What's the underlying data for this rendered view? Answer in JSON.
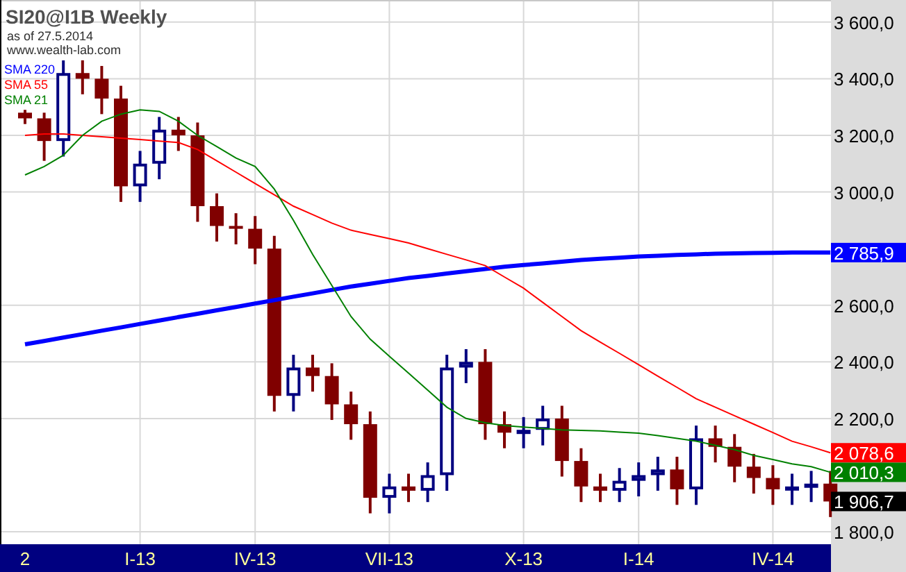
{
  "chart_data": {
    "type": "candlestick",
    "title": "SI20@I1B Weekly",
    "categories": [
      "2",
      null,
      null,
      null,
      null,
      null,
      "I-13",
      null,
      null,
      null,
      null,
      null,
      "IV-13",
      null,
      null,
      null,
      null,
      null,
      null,
      "VII-13",
      null,
      null,
      null,
      null,
      null,
      null,
      "X-13",
      null,
      null,
      null,
      null,
      null,
      "I-14",
      null,
      null,
      null,
      null,
      null,
      null,
      "IV-14",
      null,
      null,
      null
    ],
    "ylim": [
      1756,
      3678
    ],
    "grid": true,
    "yticks": [
      {
        "value": 3600,
        "label": "3 600,0"
      },
      {
        "value": 3400,
        "label": "3 400,0"
      },
      {
        "value": 3200,
        "label": "3 200,0"
      },
      {
        "value": 3000,
        "label": "3 000,0"
      },
      {
        "value": 2600,
        "label": "2 600,0"
      },
      {
        "value": 2400,
        "label": "2 400,0"
      },
      {
        "value": 2200,
        "label": "2 200,0"
      },
      {
        "value": 1800,
        "label": "1 800,0"
      }
    ],
    "ohlc": [
      [
        3280,
        3290,
        3240,
        3260
      ],
      [
        3260,
        3280,
        3110,
        3180
      ],
      [
        3180,
        3465,
        3125,
        3420
      ],
      [
        3420,
        3465,
        3345,
        3400
      ],
      [
        3400,
        3445,
        3275,
        3330
      ],
      [
        3330,
        3375,
        2965,
        3020
      ],
      [
        3020,
        3145,
        2965,
        3100
      ],
      [
        3100,
        3265,
        3045,
        3220
      ],
      [
        3220,
        3265,
        3145,
        3200
      ],
      [
        3200,
        3245,
        2895,
        2950
      ],
      [
        2950,
        2995,
        2825,
        2880
      ],
      [
        2880,
        2925,
        2815,
        2870
      ],
      [
        2870,
        2915,
        2745,
        2800
      ],
      [
        2800,
        2845,
        2225,
        2280
      ],
      [
        2280,
        2425,
        2225,
        2380
      ],
      [
        2380,
        2425,
        2295,
        2350
      ],
      [
        2350,
        2395,
        2195,
        2250
      ],
      [
        2250,
        2295,
        2125,
        2180
      ],
      [
        2180,
        2225,
        1865,
        1920
      ],
      [
        1920,
        2005,
        1865,
        1960
      ],
      [
        1960,
        2005,
        1905,
        1945
      ],
      [
        1945,
        2045,
        1905,
        2000
      ],
      [
        2000,
        2425,
        1945,
        2380
      ],
      [
        2380,
        2445,
        2325,
        2400
      ],
      [
        2400,
        2445,
        2125,
        2180
      ],
      [
        2180,
        2225,
        2095,
        2150
      ],
      [
        2150,
        2205,
        2095,
        2160
      ],
      [
        2160,
        2245,
        2105,
        2200
      ],
      [
        2200,
        2245,
        1995,
        2050
      ],
      [
        2050,
        2095,
        1905,
        1960
      ],
      [
        1960,
        2005,
        1905,
        1945
      ],
      [
        1945,
        2025,
        1905,
        1980
      ],
      [
        1980,
        2045,
        1925,
        2000
      ],
      [
        2000,
        2065,
        1945,
        2020
      ],
      [
        2020,
        2065,
        1895,
        1950
      ],
      [
        1950,
        2175,
        1895,
        2130
      ],
      [
        2130,
        2175,
        2045,
        2100
      ],
      [
        2100,
        2145,
        1975,
        2030
      ],
      [
        2030,
        2075,
        1935,
        1990
      ],
      [
        1990,
        2035,
        1895,
        1950
      ],
      [
        1950,
        2005,
        1895,
        1960
      ],
      [
        1960,
        2015,
        1905,
        1970
      ],
      [
        1970,
        2015,
        1852,
        1907
      ]
    ],
    "series": [
      {
        "name": "SMA 220",
        "type": "line",
        "color": "#0000ff",
        "values": [
          2462,
          2474,
          2486,
          2498,
          2510,
          2522,
          2534,
          2546,
          2558,
          2570,
          2582,
          2594,
          2606,
          2618,
          2630,
          2642,
          2654,
          2666,
          2676,
          2686,
          2696,
          2704,
          2712,
          2720,
          2728,
          2736,
          2742,
          2748,
          2754,
          2760,
          2764,
          2768,
          2772,
          2775,
          2778,
          2780,
          2782,
          2783,
          2784,
          2785,
          2786,
          2786,
          2786
        ]
      },
      {
        "name": "SMA 55",
        "type": "line",
        "color": "#ff0000",
        "values": [
          3200,
          3205,
          3205,
          3200,
          3195,
          3190,
          3185,
          3180,
          3175,
          3150,
          3110,
          3070,
          3030,
          2990,
          2950,
          2920,
          2890,
          2865,
          2850,
          2835,
          2820,
          2800,
          2780,
          2760,
          2740,
          2700,
          2660,
          2610,
          2560,
          2510,
          2470,
          2430,
          2390,
          2350,
          2310,
          2270,
          2240,
          2210,
          2180,
          2150,
          2120,
          2100,
          2079
        ]
      },
      {
        "name": "SMA 21",
        "type": "line",
        "color": "#008000",
        "values": [
          3060,
          3090,
          3130,
          3200,
          3250,
          3275,
          3290,
          3285,
          3250,
          3200,
          3160,
          3120,
          3090,
          3010,
          2900,
          2780,
          2670,
          2560,
          2480,
          2420,
          2360,
          2300,
          2240,
          2200,
          2185,
          2175,
          2170,
          2165,
          2160,
          2158,
          2156,
          2152,
          2148,
          2140,
          2130,
          2120,
          2105,
          2090,
          2070,
          2055,
          2040,
          2030,
          2010
        ]
      }
    ],
    "annotations": [
      "2 785,9",
      "2 078,6",
      "2 010,3",
      "1 906,7"
    ]
  },
  "header": {
    "date": "as of 27.5.2014",
    "source": "www.wealth-lab.com"
  }
}
